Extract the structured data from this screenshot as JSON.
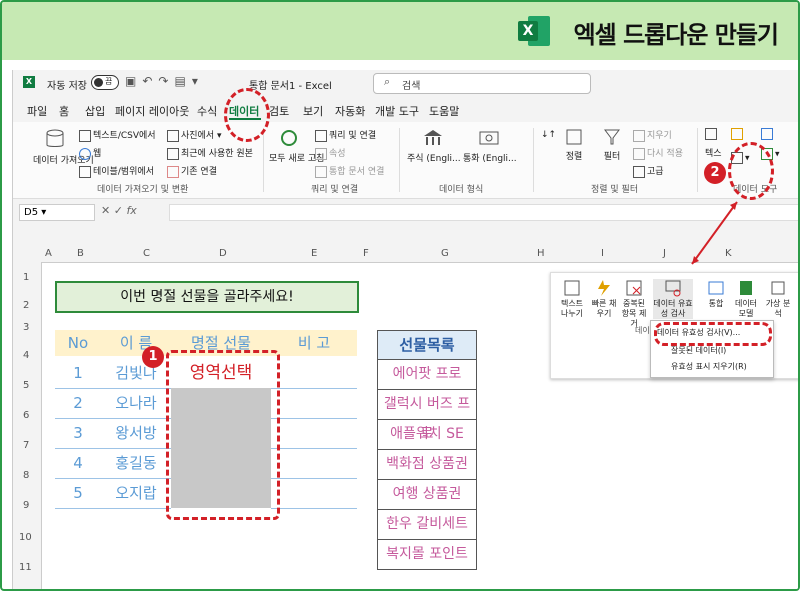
{
  "banner": {
    "title": "엑셀 드롭다운 만들기",
    "logo_letter": "X"
  },
  "titlebar": {
    "autosave_label": "자동 저장",
    "autosave_state": "끔",
    "doc_title": "통합 문서1 - Excel",
    "search_placeholder": "검색"
  },
  "menu": [
    "파일",
    "홈",
    "삽입",
    "페이지 레이아웃",
    "수식",
    "데이터",
    "검토",
    "보기",
    "자동화",
    "개발 도구",
    "도움말"
  ],
  "active_menu": "데이터",
  "ribbon": {
    "get_data": "데이터 가져오기",
    "text_csv": "텍스트/CSV에서",
    "web": "웹",
    "table_range": "테이블/범위에서",
    "picture": "사진에서",
    "recent_sources": "최근에 사용한 원본",
    "existing_conn": "기존 연결",
    "group_get": "데이터 가져오기 및 변환",
    "refresh_all": "모두 새로 고침",
    "queries": "쿼리 및 연결",
    "properties": "속성",
    "edit_links": "통합 문서 연결",
    "group_queries": "쿼리 및 연결",
    "stocks": "주식 (Engli...",
    "currency": "통화 (Engli...",
    "group_types": "데이터 형식",
    "sort": "정렬",
    "filter": "필터",
    "clear": "지우기",
    "reapply": "다시 적용",
    "advanced": "고급",
    "group_sort": "정렬 및 필터",
    "text_split": "텍스",
    "group_tools": "데이터 도구"
  },
  "formula_bar": {
    "name_box": "D5",
    "fx": "fx"
  },
  "columns": [
    "A",
    "B",
    "C",
    "D",
    "E",
    "F",
    "G",
    "H",
    "I",
    "J",
    "K"
  ],
  "rows": [
    "1",
    "2",
    "3",
    "4",
    "5",
    "6",
    "7",
    "8",
    "9",
    "10",
    "11"
  ],
  "sheet": {
    "title": "이번 명절 선물을 골라주세요!",
    "headers": [
      "No",
      "이 름",
      "명절 선물",
      "비 고"
    ],
    "rows": [
      {
        "no": "1",
        "name": "김빛나",
        "gift": "영역선택"
      },
      {
        "no": "2",
        "name": "오나라",
        "gift": ""
      },
      {
        "no": "3",
        "name": "왕서방",
        "gift": ""
      },
      {
        "no": "4",
        "name": "홍길동",
        "gift": ""
      },
      {
        "no": "5",
        "name": "오지랍",
        "gift": ""
      }
    ],
    "gift_list_header": "선물목록",
    "gift_list": [
      "에어팟 프로",
      "갤럭시 버즈 프로",
      "애플워치 SE",
      "백화점 상품권",
      "여행 상품권",
      "한우 갈비세트",
      "복지몰 포인트"
    ]
  },
  "popup": {
    "buttons": [
      "텍스트 나누기",
      "빠른 채우기",
      "중복된 항목 제거",
      "데이터 유효성 검사",
      "통합",
      "데이터 모델",
      "가상 분석"
    ],
    "group_label": "데이",
    "dropdown": [
      "데이터 유효성 검사(V)...",
      "잘못된 데이터(I)",
      "유효성 표시 지우기(R)"
    ]
  },
  "badges": [
    "1",
    "2"
  ],
  "colors": {
    "accent": "#107c41",
    "highlight": "#d32027",
    "banner": "#c6e9b3"
  }
}
